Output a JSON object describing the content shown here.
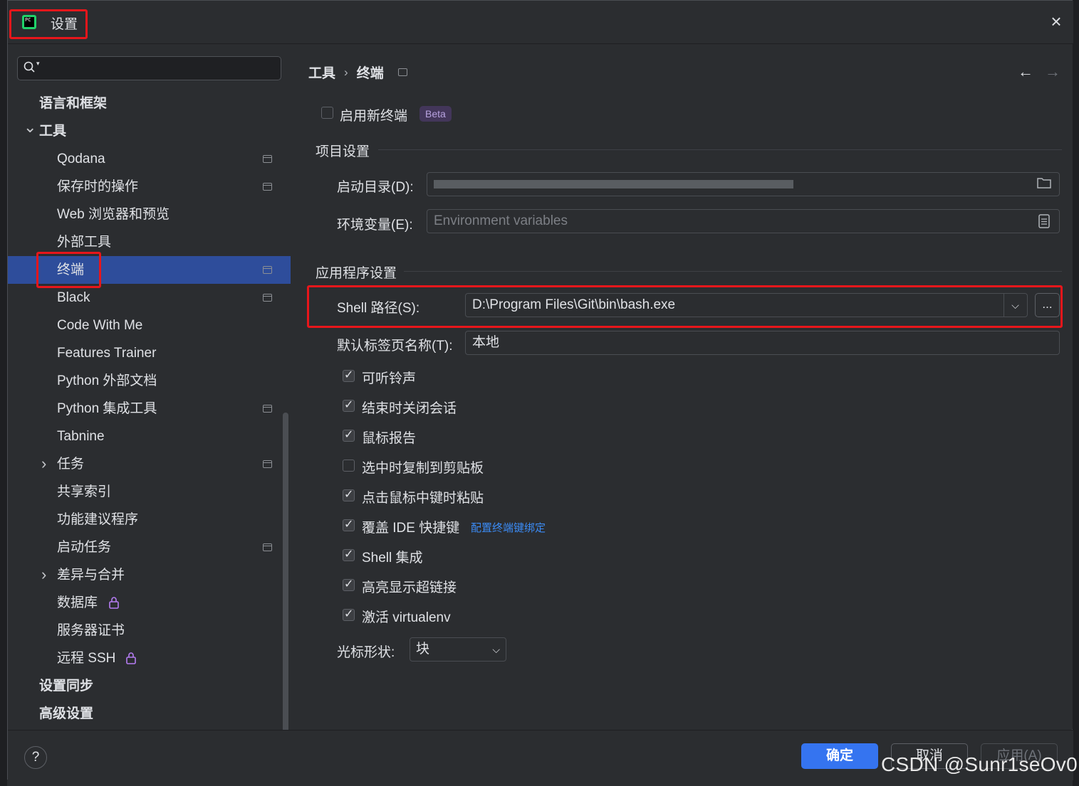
{
  "window": {
    "title": "设置",
    "close_icon": "×"
  },
  "search": {
    "placeholder": ""
  },
  "sidebar": {
    "items": [
      {
        "label": "语言和框架",
        "bold": true
      },
      {
        "label": "工具",
        "bold": true,
        "expanded": true
      },
      {
        "label": "Qodana",
        "project_icon": true
      },
      {
        "label": "保存时的操作",
        "project_icon": true
      },
      {
        "label": "Web 浏览器和预览"
      },
      {
        "label": "外部工具"
      },
      {
        "label": "终端",
        "selected": true,
        "project_icon": true
      },
      {
        "label": "Black",
        "project_icon": true
      },
      {
        "label": "Code With Me"
      },
      {
        "label": "Features Trainer"
      },
      {
        "label": "Python 外部文档"
      },
      {
        "label": "Python 集成工具",
        "project_icon": true
      },
      {
        "label": "Tabnine"
      },
      {
        "label": "任务",
        "collapsed": true,
        "project_icon": true
      },
      {
        "label": "共享索引"
      },
      {
        "label": "功能建议程序"
      },
      {
        "label": "启动任务",
        "project_icon": true
      },
      {
        "label": "差异与合并",
        "collapsed": true
      },
      {
        "label": "数据库",
        "locked": true
      },
      {
        "label": "服务器证书"
      },
      {
        "label": "远程 SSH",
        "locked": true
      },
      {
        "label": "设置同步",
        "bold": true
      },
      {
        "label": "高级设置",
        "bold": true
      }
    ]
  },
  "breadcrumb": {
    "parent": "工具",
    "separator": "›",
    "current": "终端"
  },
  "nav": {
    "back": "←",
    "forward": "→"
  },
  "new_terminal": {
    "label": "启用新终端",
    "checked": false,
    "badge": "Beta"
  },
  "project_settings": {
    "title": "项目设置",
    "start_dir_label": "启动目录(D):",
    "start_dir_value": "",
    "env_label": "环境变量(E):",
    "env_placeholder": "Environment variables"
  },
  "app_settings": {
    "title": "应用程序设置",
    "shell_label": "Shell 路径(S):",
    "shell_value": "D:\\Program Files\\Git\\bin\\bash.exe",
    "browse_label": "...",
    "tab_name_label": "默认标签页名称(T):",
    "tab_name_value": "本地",
    "options": [
      {
        "label": "可听铃声",
        "checked": true
      },
      {
        "label": "结束时关闭会话",
        "checked": true
      },
      {
        "label": "鼠标报告",
        "checked": true
      },
      {
        "label": "选中时复制到剪贴板",
        "checked": false
      },
      {
        "label": "点击鼠标中键时粘贴",
        "checked": true
      },
      {
        "label": "覆盖 IDE 快捷键",
        "checked": true,
        "link": "配置终端键绑定"
      },
      {
        "label": "Shell 集成",
        "checked": true
      },
      {
        "label": "高亮显示超链接",
        "checked": true
      },
      {
        "label": "激活 virtualenv",
        "checked": true
      }
    ],
    "cursor_label": "光标形状:",
    "cursor_value": "块"
  },
  "footer": {
    "help": "?",
    "ok": "确定",
    "cancel": "取消",
    "apply": "应用(A)"
  },
  "watermark": "CSDN @Sunr1seOv0",
  "colors": {
    "accent": "#3574f0",
    "selection": "#2e4d9b",
    "highlight_box": "#e8161b",
    "background": "#2b2d30"
  }
}
